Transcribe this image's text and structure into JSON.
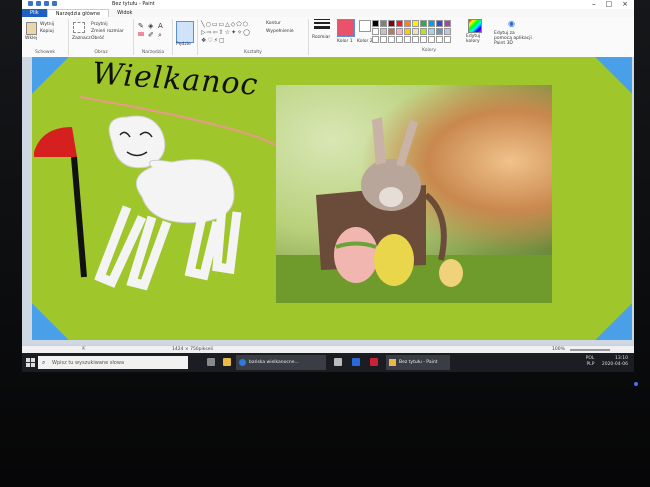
{
  "window": {
    "title": "Bez tytułu - Paint"
  },
  "tabs": [
    {
      "label": "Plik"
    },
    {
      "label": "Narzędzia główne"
    },
    {
      "label": "Widok"
    }
  ],
  "ribbon": {
    "clipboard": {
      "paste": "Wklej",
      "cut": "Wytnij",
      "copy": "Kopiuj",
      "group": "Schowek"
    },
    "image": {
      "select": "Zaznacz",
      "crop": "Przytnij",
      "resize": "Zmień rozmiar",
      "rotate": "Obróć",
      "group": "Obraz"
    },
    "tools": {
      "group": "Narzędzia"
    },
    "brushes": {
      "label": "Pędzle"
    },
    "shapes": {
      "outline": "Kontur",
      "fill": "Wypełnienie",
      "group": "Kształty"
    },
    "size": {
      "label": "Rozmiar"
    },
    "colors": {
      "color1": "Kolor 1",
      "color2": "Kolor 2",
      "edit": "Edytuj kolory",
      "paint3d": "Edytuj za pomocą aplikacji Paint 3D",
      "group": "Kolory",
      "accent": "#e8536a",
      "palette": [
        "#000000",
        "#7f7f7f",
        "#880015",
        "#ed1c24",
        "#ff7f27",
        "#fff200",
        "#22b14c",
        "#00a2e8",
        "#3f48cc",
        "#a349a4",
        "#ffffff",
        "#c3c3c3",
        "#b97a57",
        "#ffaec9",
        "#ffc90e",
        "#efe4b0",
        "#b5e61d",
        "#99d9ea",
        "#7092be",
        "#c8bfe7",
        "#ffffff",
        "#ffffff",
        "#ffffff",
        "#ffffff",
        "#ffffff",
        "#ffffff",
        "#ffffff",
        "#ffffff",
        "#ffffff",
        "#ffffff"
      ]
    }
  },
  "canvas": {
    "handwriting": "Wielkanoc",
    "background": "#9fc62a",
    "corner_color": "#4aa0e8"
  },
  "statusbar": {
    "size": "1424 × 750pikseli",
    "zoom": "100%"
  },
  "taskbar": {
    "search_placeholder": "Wpisz tu wyszukiwane słowa",
    "browser_window": "bańska wielkanocne...",
    "paint_window": "Bez tytułu - Paint",
    "lang": "POL",
    "lang2": "PLP",
    "time": "13:10",
    "date": "2020-04-06"
  }
}
